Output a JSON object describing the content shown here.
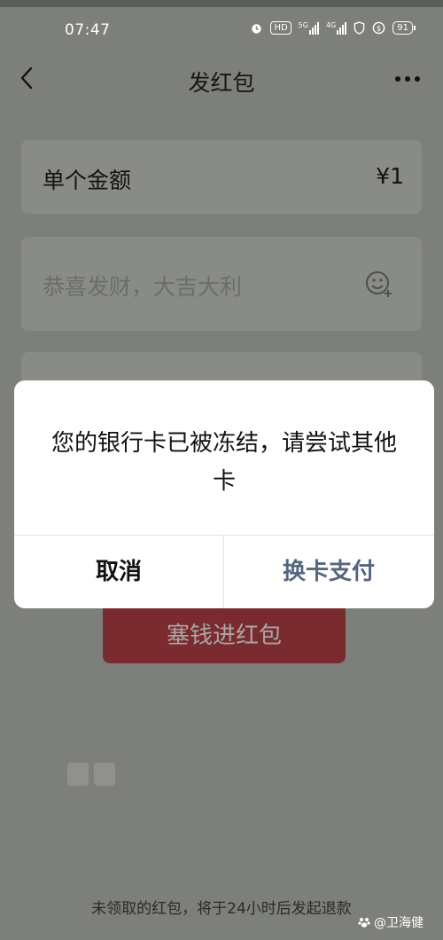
{
  "status_bar": {
    "time": "07:47",
    "hd_label": "HD",
    "signal_1": "5G",
    "signal_2": "4G",
    "battery": "91"
  },
  "nav": {
    "title": "发红包"
  },
  "amount_row": {
    "label": "单个金额",
    "value": "¥1"
  },
  "greeting": {
    "placeholder": "恭喜发财，大吉大利"
  },
  "send_button": {
    "label": "塞钱进红包"
  },
  "dialog": {
    "message": "您的银行卡已被冻结，请尝试其他卡",
    "cancel_label": "取消",
    "switch_label": "换卡支付"
  },
  "footer": {
    "note": "未领取的红包，将于24小时后发起退款"
  },
  "watermark": {
    "text": "@卫海健"
  }
}
